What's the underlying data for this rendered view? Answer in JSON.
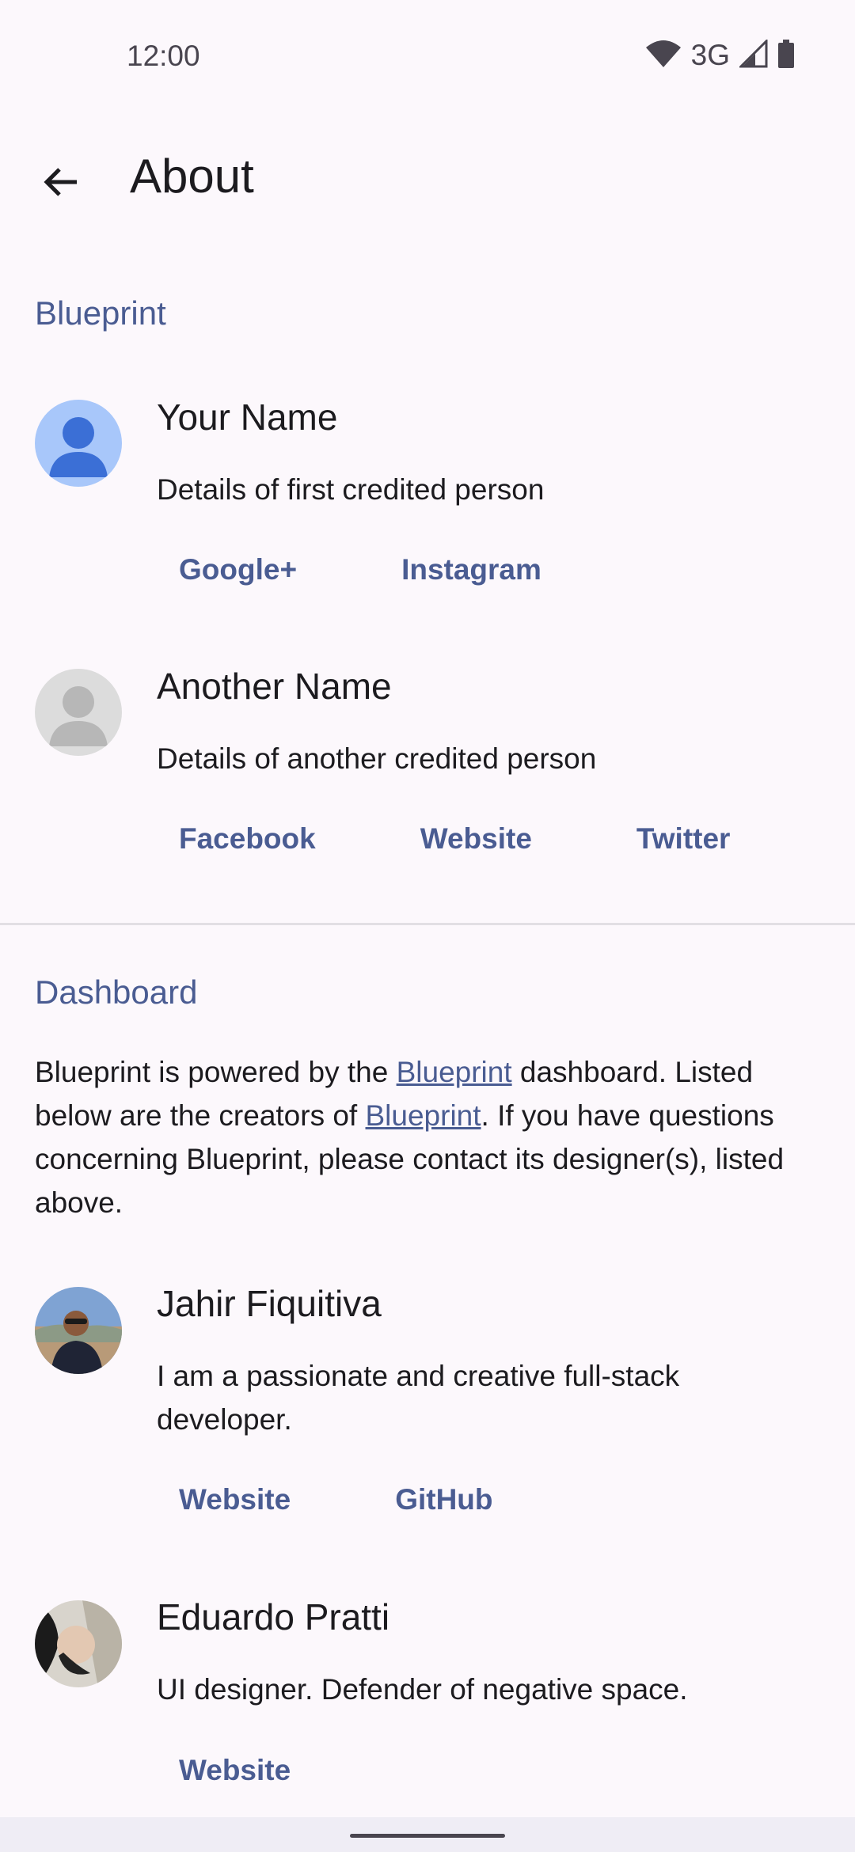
{
  "status_bar": {
    "time": "12:00",
    "network": "3G"
  },
  "app_bar": {
    "title": "About"
  },
  "sections": {
    "blueprint": {
      "header": "Blueprint"
    },
    "dashboard": {
      "header": "Dashboard",
      "text_1": "Blueprint is powered by the ",
      "link_1": "Blueprint",
      "text_2": " dashboard. Listed below are the creators of ",
      "link_2": "Blueprint",
      "text_3": ". If you have questions concerning Blueprint, please contact its designer(s), listed above."
    }
  },
  "people": [
    {
      "name": "Your Name",
      "desc": "Details of first credited person",
      "links": [
        "Google+",
        "Instagram"
      ]
    },
    {
      "name": "Another Name",
      "desc": "Details of another credited person",
      "links": [
        "Facebook",
        "Website",
        "Twitter"
      ]
    },
    {
      "name": "Jahir Fiquitiva",
      "desc": "I am a passionate and creative full-stack developer.",
      "links": [
        "Website",
        "GitHub"
      ]
    },
    {
      "name": "Eduardo Pratti",
      "desc": "UI designer. Defender of negative space.",
      "links": [
        "Website"
      ]
    }
  ],
  "colors": {
    "accent": "#4a5c92",
    "background": "#fcf8fc",
    "avatar_blue": "#a8c7fa",
    "avatar_grey": "#dcdcdc"
  }
}
